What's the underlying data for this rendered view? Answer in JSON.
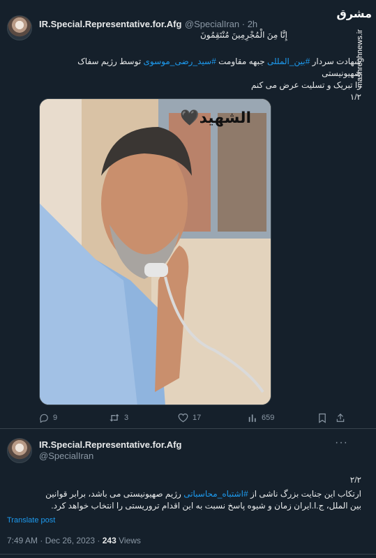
{
  "tweet1": {
    "name": "IR.Special.Representative.for.Afg",
    "handle": "@SpecialIran · 2h",
    "quote": "إِنَّا مِنَ الْمُجْرِمِينَ مُنْتَقِمُونَ",
    "line1_pre": "شهادت سردار",
    "tag1": "#بین_المللی",
    "line1_mid": "جبهه مقاومت",
    "tag2": "#سید_رضی_موسوی",
    "line1_post": "توسط رژیم سفاک صهیونیستی",
    "line2": "را تبریک و تسلیت عرض می کنم",
    "line3": "۱/۲",
    "image_caption": "الشهید🖤"
  },
  "actions": {
    "replies": "9",
    "retweets": "3",
    "likes": "17",
    "views": "659"
  },
  "tweet2": {
    "name": "IR.Special.Representative.for.Afg",
    "handle": "@SpecialIran",
    "counter": "۲/۲",
    "line1_pre": "ارتکاب این جنایت بزرگ ناشی از",
    "tag": "#اشتباه_محاسباتی",
    "line1_post": "رژیم صهیونیستی می باشد، برابر قوانین",
    "line2": "بین الملل، ج.ا.ایران زمان و شیوه پاسخ نسبت به این اقدام تروریستی را انتخاب خواهد کرد.",
    "translate": "Translate post",
    "timestamp": "7:49 AM · Dec 26, 2023 ·",
    "views_count": "243",
    "views_label": "Views"
  },
  "watermark": {
    "logo": "مشرق",
    "site": "mashreghnews.ir"
  },
  "colors": {
    "background": "#15202b",
    "link": "#1d9bf0",
    "muted": "#8b98a5"
  }
}
